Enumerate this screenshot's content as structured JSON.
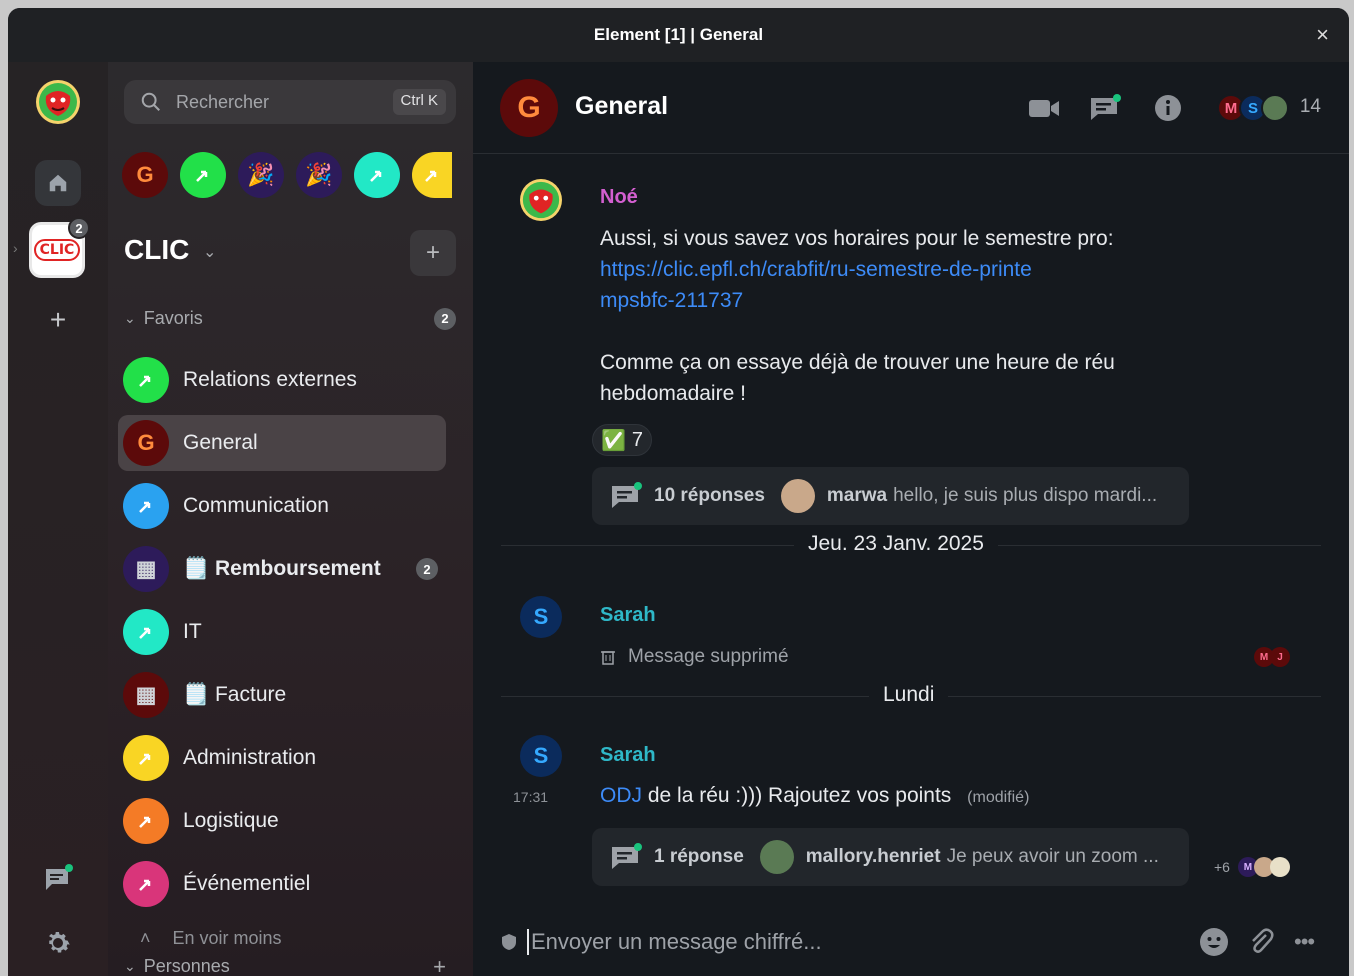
{
  "window": {
    "title": "Element [1] | General",
    "close_label": "×"
  },
  "spaces_bar": {
    "space_name": "CLIC",
    "space_badge": "2",
    "add_label": "+"
  },
  "search": {
    "placeholder": "Rechercher",
    "shortcut": "Ctrl K"
  },
  "recent_rooms": [
    {
      "letter": "G",
      "bg": "#5c0a0a",
      "fg": "#ff8b3d"
    },
    {
      "letter": "",
      "bg": "#22e049"
    },
    {
      "letter": "🎉",
      "bg": "#2d1b5a"
    },
    {
      "letter": "🎉",
      "bg": "#2d1b5a"
    },
    {
      "letter": "",
      "bg": "#22e8c6"
    },
    {
      "letter": "",
      "bg": "#f9d524"
    }
  ],
  "space_header": {
    "title": "CLIC",
    "add_label": "+"
  },
  "favorites": {
    "label": "Favoris",
    "badge": "2",
    "rooms": [
      {
        "name": "Relations externes",
        "avatar_color": "#22e049",
        "letter": "",
        "active": false
      },
      {
        "name": "General",
        "avatar_color": "#5c0a0a",
        "letter": "G",
        "active": true
      },
      {
        "name": "Communication",
        "avatar_color": "#2aa2f0",
        "letter": ""
      },
      {
        "name": "🗒️ Remboursement",
        "avatar_color": "#2d1b5a",
        "letter": "▦",
        "badge": "2",
        "bold": true
      },
      {
        "name": "IT",
        "avatar_color": "#22e8c6",
        "letter": ""
      },
      {
        "name": "🗒️ Facture",
        "avatar_color": "#5c0a0a",
        "letter": "▦"
      },
      {
        "name": "Administration",
        "avatar_color": "#f9d524",
        "letter": ""
      },
      {
        "name": "Logistique",
        "avatar_color": "#f47b26",
        "letter": ""
      },
      {
        "name": "Événementiel",
        "avatar_color": "#d9357a",
        "letter": ""
      }
    ],
    "show_less": "En voir moins"
  },
  "people": {
    "label": "Personnes",
    "add_label": "+"
  },
  "room_header": {
    "avatar_letter": "G",
    "title": "General",
    "member_count": "14",
    "member_letters": [
      "M",
      "S"
    ]
  },
  "messages": {
    "noe": {
      "sender": "Noé",
      "text1": "Aussi, si vous savez vos horaires pour le semestre pro:",
      "link": "https://clic.epfl.ch/crabfit/ru-semestre-de-printempsbfc-211737",
      "text2": "Comme ça on essaye déjà de trouver une heure de réu hebdomadaire !",
      "reaction_emoji": "✅",
      "reaction_count": "7",
      "thread_count": "10 réponses",
      "thread_user": "marwa",
      "thread_preview": "hello, je suis plus dispo mardi..."
    },
    "date1": "Jeu. 23 Janv. 2025",
    "sarah1": {
      "sender": "Sarah",
      "avatar_letter": "S",
      "deleted": "Message supprimé",
      "receipts": [
        "M",
        "J"
      ]
    },
    "date2": "Lundi",
    "sarah2": {
      "sender": "Sarah",
      "avatar_letter": "S",
      "time": "17:31",
      "link_text": "ODJ",
      "text": " de la réu :))) Rajoutez vos points",
      "edited": "(modifié)",
      "thread_count": "1 réponse",
      "thread_user": "mallory.henriet",
      "thread_preview": "Je peux avoir un zoom ...",
      "receipts_more": "+6",
      "receipts": [
        "M"
      ]
    }
  },
  "composer": {
    "placeholder": "Envoyer un message chiffré..."
  }
}
